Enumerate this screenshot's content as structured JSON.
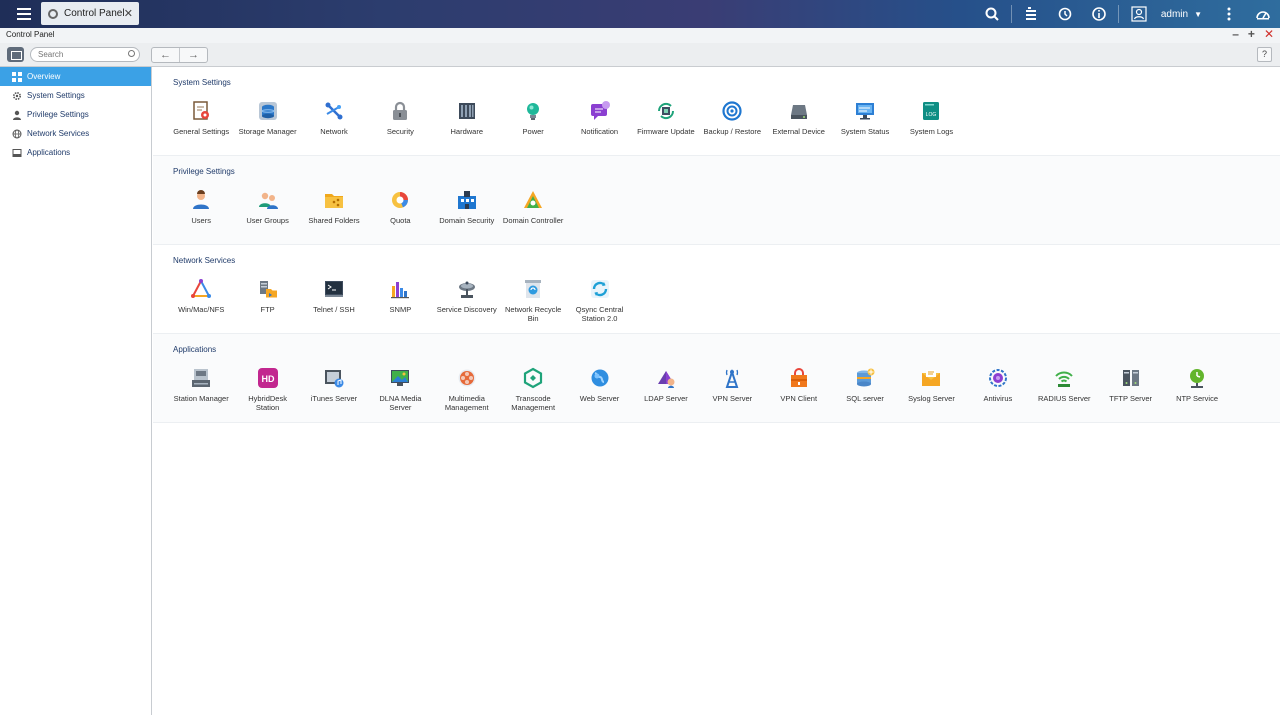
{
  "topbar": {
    "app_tab": "Control Panel",
    "user": "admin"
  },
  "window": {
    "title": "Control Panel"
  },
  "toolbar": {
    "search_placeholder": "Search",
    "back": "←",
    "forward": "→",
    "help": "?"
  },
  "sidebar": {
    "items": [
      {
        "label": "Overview",
        "icon": "grid-icon"
      },
      {
        "label": "System Settings",
        "icon": "gear-icon"
      },
      {
        "label": "Privilege Settings",
        "icon": "user-icon"
      },
      {
        "label": "Network Services",
        "icon": "globe-icon"
      },
      {
        "label": "Applications",
        "icon": "drive-icon"
      }
    ]
  },
  "sections": {
    "system": {
      "title": "System Settings",
      "items": [
        "General Settings",
        "Storage Manager",
        "Network",
        "Security",
        "Hardware",
        "Power",
        "Notification",
        "Firmware Update",
        "Backup / Restore",
        "External Device",
        "System Status",
        "System Logs"
      ]
    },
    "privilege": {
      "title": "Privilege Settings",
      "items": [
        "Users",
        "User Groups",
        "Shared Folders",
        "Quota",
        "Domain Security",
        "Domain Controller"
      ]
    },
    "network": {
      "title": "Network Services",
      "items": [
        "Win/Mac/NFS",
        "FTP",
        "Telnet / SSH",
        "SNMP",
        "Service Discovery",
        "Network Recycle Bin",
        "Qsync Central Station 2.0"
      ]
    },
    "applications": {
      "title": "Applications",
      "items": [
        "Station Manager",
        "HybridDesk Station",
        "iTunes Server",
        "DLNA Media Server",
        "Multimedia Management",
        "Transcode Management",
        "Web Server",
        "LDAP Server",
        "VPN Server",
        "VPN Client",
        "SQL server",
        "Syslog Server",
        "Antivirus",
        "RADIUS Server",
        "TFTP Server",
        "NTP Service"
      ]
    }
  },
  "icon_glyphs": {
    "logs": "LOG",
    "hybriddesk": "HD"
  }
}
